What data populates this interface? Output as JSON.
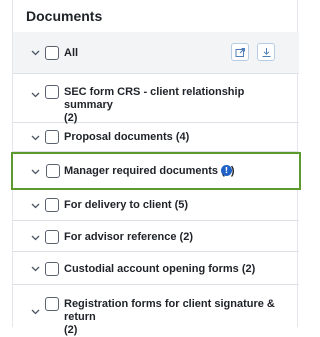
{
  "panel": {
    "title": "Documents"
  },
  "all_row": {
    "label": "All"
  },
  "items": [
    {
      "label": "SEC form CRS - client relationship summary",
      "count": "(2)"
    },
    {
      "label": "Proposal documents (4)"
    },
    {
      "label": "Manager required documents (2)",
      "info_icon": "!"
    },
    {
      "label": "For delivery to client (5)"
    },
    {
      "label": "For advisor reference (2)"
    },
    {
      "label": "Custodial account opening forms (2)"
    },
    {
      "label": "Registration forms for client signature & return",
      "count": "(2)"
    }
  ],
  "colors": {
    "highlight": "#5c9a2f",
    "info": "#1f61c7",
    "button_border": "#b7cde3"
  },
  "icons": {
    "expand": "chevron-down-icon",
    "share": "share-icon",
    "download": "download-icon",
    "info": "info-icon"
  }
}
